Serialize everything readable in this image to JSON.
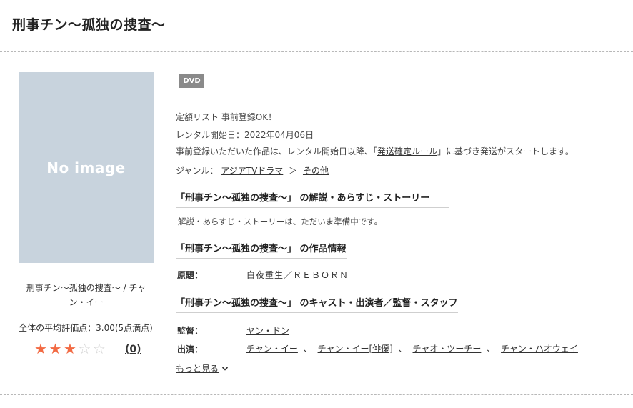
{
  "page_title": "刑事チン〜孤独の捜査〜",
  "cover": {
    "placeholder": "No image"
  },
  "left": {
    "title": "刑事チン〜孤独の捜査〜 / チャン・イー",
    "avg_rating_text": "全体の平均評価点：3.00(5点満点)",
    "rating": 3,
    "rating_max": 5,
    "review_count": "(0)"
  },
  "badge": "DVD",
  "info": {
    "line1": "定額リスト 事前登録OK！",
    "line2": "レンタル開始日：2022年04月06日",
    "line3_pre": "事前登録いただいた作品は、レンタル開始日以降、「",
    "line3_link": "発送確定ルール",
    "line3_post": "」に基づき発送がスタートします。",
    "genre_label": "ジャンル：",
    "genre1": "アジアTVドラマ",
    "genre_sep": "＞",
    "genre2": "その他"
  },
  "sections": {
    "story_heading": "「刑事チン〜孤独の捜査〜」 の解説・あらすじ・ストーリー",
    "story_text": "解説・あらすじ・ストーリーは、ただいま準備中です。",
    "work_heading": "「刑事チン〜孤独の捜査〜」 の作品情報",
    "original_label": "原題：",
    "original_value": "白夜重生／ＲＥＢＯＲＮ",
    "cast_heading": "「刑事チン〜孤独の捜査〜」 のキャスト・出演者／監督・スタッフ",
    "director_label": "監督：",
    "director_value": "ヤン・ドン",
    "cast_label": "出演：",
    "cast": [
      "チャン・イー",
      "チャン・イー[俳優]",
      "チャオ・ツーチー",
      "チャン・ハオウェイ"
    ],
    "cast_sep": "、"
  },
  "more": "もっと見る"
}
